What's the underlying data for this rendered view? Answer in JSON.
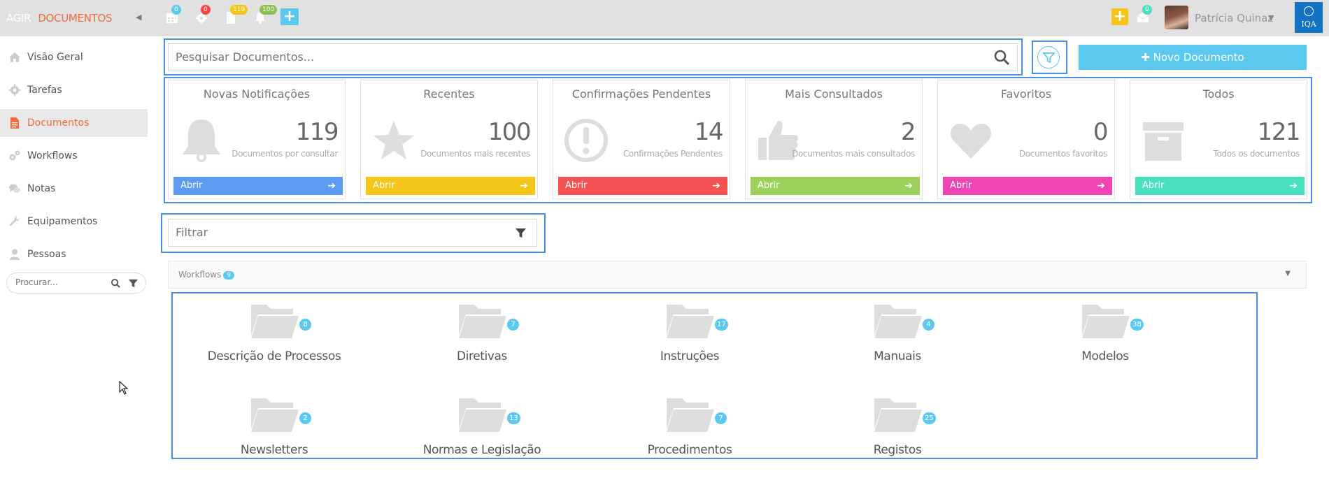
{
  "topbar": {
    "brand": "AGIR",
    "module": "DOCUMENTOS",
    "collapse_icon": "chevron-left-icon",
    "icons": [
      {
        "name": "calendar-icon",
        "badge": "0",
        "badge_color": "#5bc8f0"
      },
      {
        "name": "gears-icon",
        "badge": "0",
        "badge_color": "#f0484a"
      },
      {
        "name": "document-icon",
        "badge": "119",
        "badge_color": "#f5c518"
      },
      {
        "name": "bell-icon",
        "badge": "100",
        "badge_color": "#8cc152"
      }
    ],
    "add_button": "+",
    "right_add_button": "+",
    "messages_badge": "0",
    "user_name": "Patrícia Quinaz",
    "logo_text": "IQA"
  },
  "sidebar": {
    "items": [
      {
        "label": "Visão Geral",
        "icon": "home-icon"
      },
      {
        "label": "Tarefas",
        "icon": "gear-icon"
      },
      {
        "label": "Documentos",
        "icon": "file-icon"
      },
      {
        "label": "Workflows",
        "icon": "gears-icon"
      },
      {
        "label": "Notas",
        "icon": "comments-icon"
      },
      {
        "label": "Equipamentos",
        "icon": "wrench-icon"
      },
      {
        "label": "Pessoas",
        "icon": "user-icon"
      }
    ],
    "active_index": 2,
    "search_placeholder": "Procurar..."
  },
  "main": {
    "search_placeholder": "Pesquisar Documentos...",
    "new_document_label": "Novo Documento",
    "filter_placeholder": "Filtrar",
    "cards": [
      {
        "title": "Novas Notificações",
        "value": "119",
        "subtitle": "Documentos por consultar",
        "button": "Abrir",
        "color": "#5b9cf2",
        "icon": "bell-icon"
      },
      {
        "title": "Recentes",
        "value": "100",
        "subtitle": "Documentos mais recentes",
        "button": "Abrir",
        "color": "#f5c518",
        "icon": "star-icon"
      },
      {
        "title": "Confirmações Pendentes",
        "value": "14",
        "subtitle": "Confirmações Pendentes",
        "button": "Abrir",
        "color": "#f55353",
        "icon": "exclamation-circle-icon"
      },
      {
        "title": "Mais Consultados",
        "value": "2",
        "subtitle": "Documentos mais consultados",
        "button": "Abrir",
        "color": "#9dd15b",
        "icon": "thumbs-up-icon"
      },
      {
        "title": "Favoritos",
        "value": "0",
        "subtitle": "Documentos favoritos",
        "button": "Abrir",
        "color": "#f044b5",
        "icon": "heart-icon"
      },
      {
        "title": "Todos",
        "value": "121",
        "subtitle": "Todos os documentos",
        "button": "Abrir",
        "color": "#48e0bf",
        "icon": "archive-icon"
      }
    ],
    "workflows": {
      "label": "Workflows",
      "count": "9"
    },
    "folders": [
      {
        "label": "Descrição de Processos",
        "count": "8"
      },
      {
        "label": "Diretivas",
        "count": "7"
      },
      {
        "label": "Instruções",
        "count": "17"
      },
      {
        "label": "Manuais",
        "count": "4"
      },
      {
        "label": "Modelos",
        "count": "38"
      },
      {
        "label": "Newsletters",
        "count": "2"
      },
      {
        "label": "Normas e Legislação",
        "count": "13"
      },
      {
        "label": "Procedimentos",
        "count": "7"
      },
      {
        "label": "Registos",
        "count": "25"
      }
    ]
  }
}
